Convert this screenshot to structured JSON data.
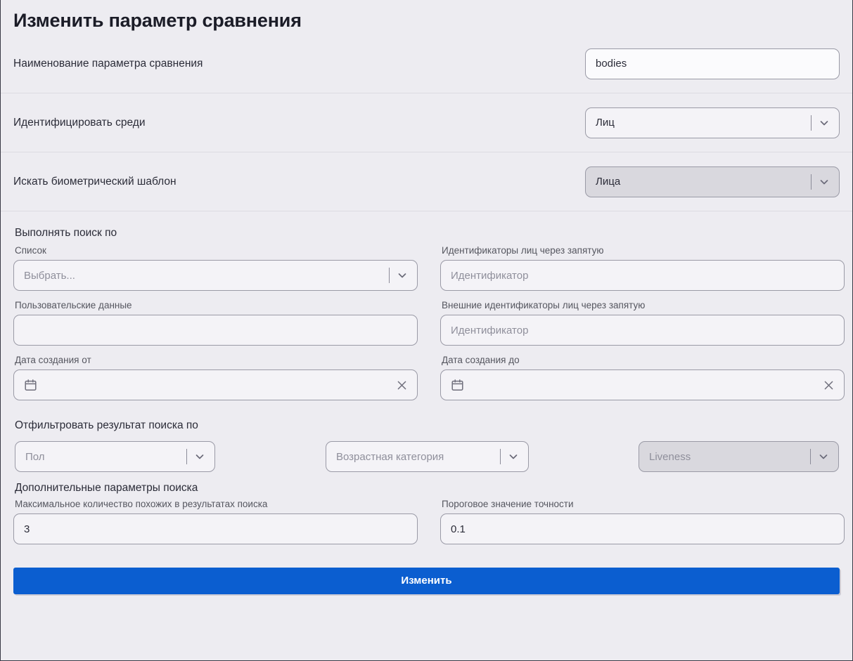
{
  "page": {
    "title": "Изменить параметр сравнения"
  },
  "rows": [
    {
      "label": "Наименование параметра сравнения",
      "control": "text",
      "value": "bodies",
      "placeholder": ""
    },
    {
      "label": "Идентифицировать среди",
      "control": "select",
      "value": "Лиц"
    },
    {
      "label": "Искать биометрический шаблон",
      "control": "select",
      "value": "Лица"
    }
  ],
  "search_section": {
    "title": "Выполнять поиск по",
    "fields": {
      "list": {
        "label": "Список",
        "value": "Выбрать..."
      },
      "face_ids": {
        "label": "Идентификаторы лиц через запятую",
        "value": "",
        "placeholder": "Идентификатор"
      },
      "user_data": {
        "label": "Пользовательские данные",
        "value": "",
        "placeholder": ""
      },
      "external_ids": {
        "label": "Внешние идентификаторы лиц через запятую",
        "value": "",
        "placeholder": "Идентификатор"
      },
      "date_from": {
        "label": "Дата создания от",
        "value": "",
        "placeholder": ""
      },
      "date_to": {
        "label": "Дата создания до",
        "value": "",
        "placeholder": ""
      }
    }
  },
  "filter_section": {
    "title": "Отфильтровать результат поиска по",
    "gender": "Пол",
    "age_category": "Возрастная категория",
    "liveness": "Liveness"
  },
  "extra_section": {
    "title": "Дополнительные параметры поиска",
    "max_similar": {
      "label": "Максимальное количество похожих в результатах поиска",
      "value": "3"
    },
    "threshold": {
      "label": "Пороговое значение точности",
      "value": "0.1"
    }
  },
  "submit": {
    "label": "Изменить"
  },
  "icons": {
    "chevron_down": "chevron-down-icon",
    "calendar": "calendar-icon",
    "clear": "clear-icon"
  },
  "colors": {
    "accent": "#0b5ed0",
    "background": "#edecf1",
    "field_border": "#9a9aa6",
    "disabled_field": "#d9d8de"
  }
}
